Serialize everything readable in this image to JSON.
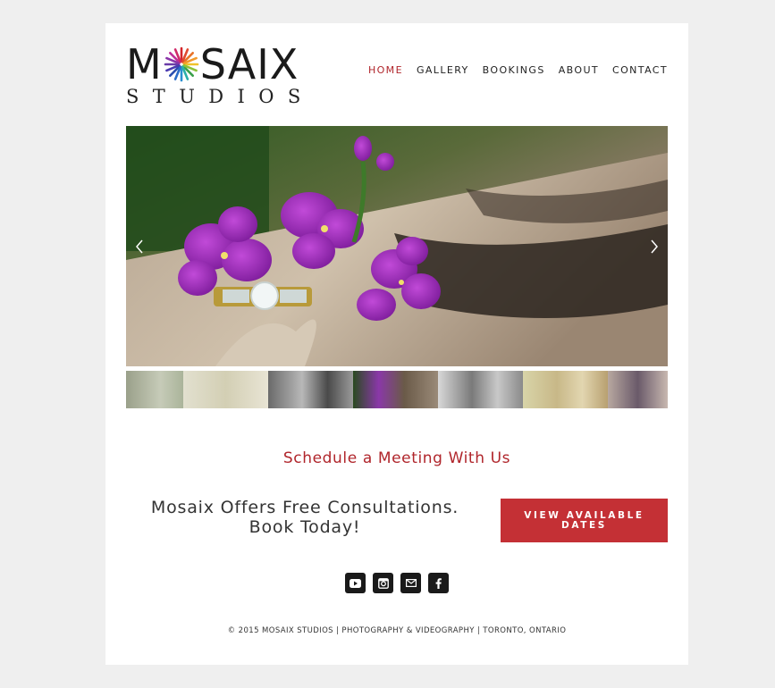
{
  "header": {
    "logo_word": "MOSAIX",
    "logo_prefix": "M",
    "logo_suffix": "SAIX",
    "logo_sub": "STUDIOS",
    "nav": [
      {
        "label": "HOME",
        "active": true
      },
      {
        "label": "GALLERY",
        "active": false
      },
      {
        "label": "BOOKINGS",
        "active": false
      },
      {
        "label": "ABOUT",
        "active": false
      },
      {
        "label": "CONTACT",
        "active": false
      }
    ]
  },
  "slideshow": {
    "prev_icon": "chevron-left-icon",
    "next_icon": "chevron-right-icon",
    "thumbnail_count": 7,
    "active_thumbnail": 4
  },
  "main": {
    "schedule_heading": "Schedule a Meeting With Us",
    "offer_line1": "Mosaix Offers Free Consultations.",
    "offer_line2": "Book Today!",
    "cta_label": "VIEW AVAILABLE DATES"
  },
  "social": [
    "youtube-icon",
    "instagram-icon",
    "email-icon",
    "facebook-icon"
  ],
  "footer": {
    "text": "© 2015 MOSAIX STUDIOS | PHOTOGRAPHY & VIDEOGRAPHY | TORONTO, ONTARIO"
  },
  "colors": {
    "accent": "#b0252b",
    "button": "#c43035",
    "background": "#efefef"
  }
}
